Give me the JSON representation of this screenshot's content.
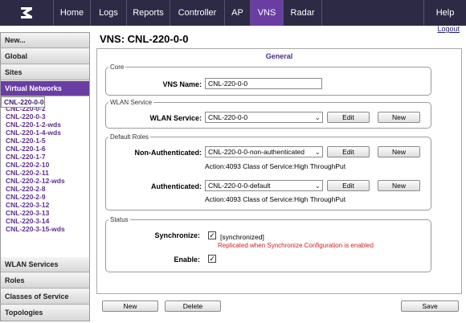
{
  "nav": {
    "tabs": [
      "Home",
      "Logs",
      "Reports",
      "Controller",
      "AP",
      "VNS",
      "Radar"
    ],
    "help": "Help",
    "logout": "Logout"
  },
  "sidebar": {
    "new": "New...",
    "global": "Global",
    "sites": "Sites",
    "virtual_networks": "Virtual Networks",
    "vns_items": [
      "CNL-220-0-0",
      "CNL-220-0-1",
      "CNL-220-0-2",
      "CNL-220-0-3",
      "CNL-220-1-2-wds",
      "CNL-220-1-4-wds",
      "CNL-220-1-5",
      "CNL-220-1-6",
      "CNL-220-1-7",
      "CNL-220-2-10",
      "CNL-220-2-11",
      "CNL-220-2-12-wds",
      "CNL-220-2-8",
      "CNL-220-2-9",
      "CNL-220-3-12",
      "CNL-220-3-13",
      "CNL-220-3-14",
      "CNL-220-3-15-wds"
    ],
    "wlan_services": "WLAN Services",
    "roles": "Roles",
    "classes_of_service": "Classes of Service",
    "topologies": "Topologies"
  },
  "main": {
    "title": "VNS: CNL-220-0-0",
    "panel_title": "General",
    "core": {
      "legend": "Core",
      "vns_name_label": "VNS Name:",
      "vns_name_value": "CNL-220-0-0"
    },
    "wlan": {
      "legend": "WLAN Service",
      "label": "WLAN Service:",
      "value": "CNL-220-0-0",
      "edit": "Edit",
      "new": "New"
    },
    "roles": {
      "legend": "Default Roles",
      "non_auth_label": "Non-Authenticated:",
      "non_auth_value": "CNL-220-0-0-non-authenticated",
      "non_auth_info": "Action:4093  Class of Service:High ThroughPut",
      "auth_label": "Authenticated:",
      "auth_value": "CNL-220-0-0-default",
      "auth_info": "Action:4093  Class of Service:High ThroughPut",
      "edit": "Edit",
      "new": "New"
    },
    "status": {
      "legend": "Status",
      "sync_label": "Synchronize:",
      "sync_text": "[synchronized]",
      "sync_note": "Replicated when Synchronize Configuration is enabled",
      "enable_label": "Enable:",
      "sync_checked": true,
      "enable_checked": true
    }
  },
  "footer": {
    "new": "New",
    "delete": "Delete",
    "save": "Save"
  },
  "colors": {
    "topbar": "#2d2a45",
    "active": "#6a3da3",
    "link": "#5b2f8f",
    "warning": "#d02020"
  }
}
